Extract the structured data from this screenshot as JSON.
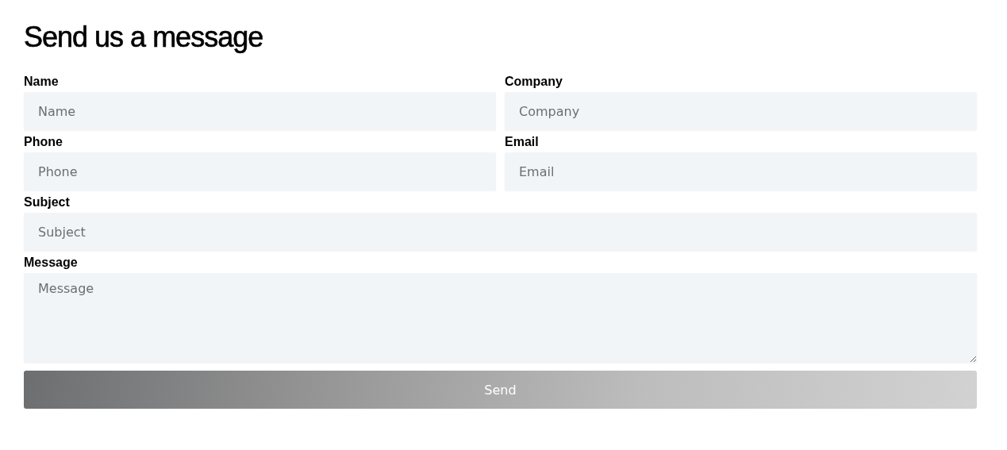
{
  "title": "Send us a message",
  "rows": [
    [
      {
        "kind": "input",
        "label": "Name",
        "placeholder": "Name"
      },
      {
        "kind": "input",
        "label": "Company",
        "placeholder": "Company"
      }
    ],
    [
      {
        "kind": "input",
        "label": "Phone",
        "placeholder": "Phone"
      },
      {
        "kind": "input",
        "label": "Email",
        "placeholder": "Email"
      }
    ],
    [
      {
        "kind": "input",
        "label": "Subject",
        "placeholder": "Subject"
      }
    ],
    [
      {
        "kind": "textarea",
        "label": "Message",
        "placeholder": "Message"
      }
    ]
  ],
  "button": {
    "label": "Send"
  }
}
